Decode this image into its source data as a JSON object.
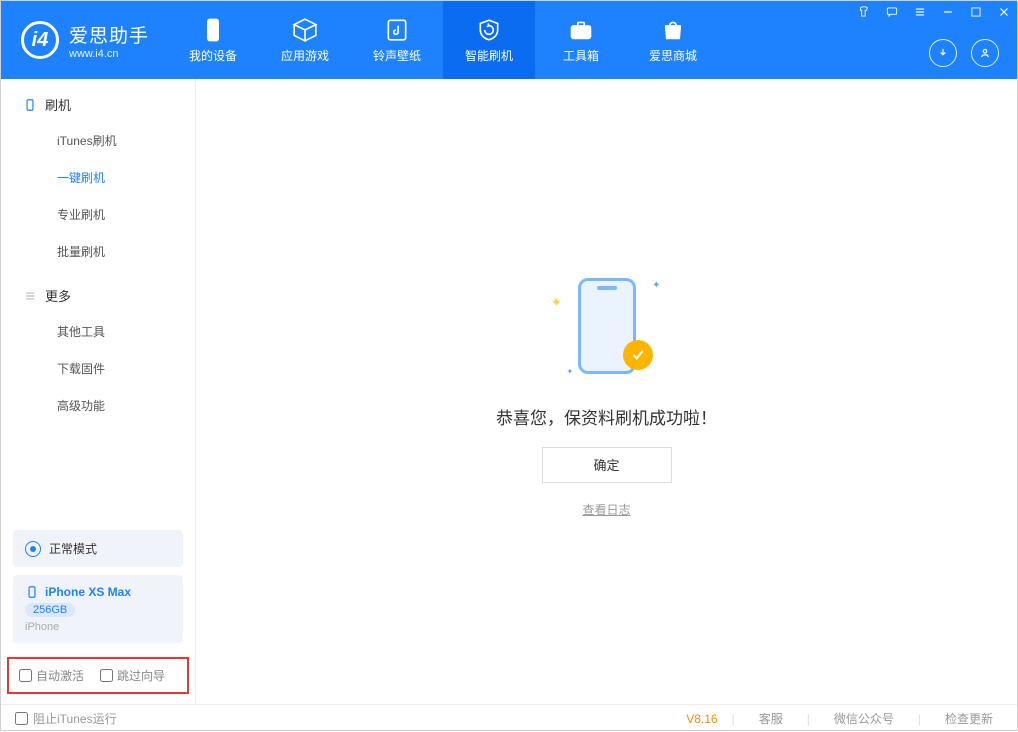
{
  "logo": {
    "cn": "爱思助手",
    "en": "www.i4.cn"
  },
  "nav": {
    "device": "我的设备",
    "apps": "应用游戏",
    "ring": "铃声壁纸",
    "flash": "智能刷机",
    "tools": "工具箱",
    "store": "爱思商城"
  },
  "sidebar": {
    "section_flash": "刷机",
    "itunes": "iTunes刷机",
    "oneclick": "一键刷机",
    "pro": "专业刷机",
    "batch": "批量刷机",
    "section_more": "更多",
    "othertools": "其他工具",
    "firmware": "下载固件",
    "advanced": "高级功能"
  },
  "status": {
    "mode": "正常模式"
  },
  "device": {
    "name": "iPhone XS Max",
    "capacity": "256GB",
    "type": "iPhone"
  },
  "opts": {
    "auto_activate": "自动激活",
    "skip_guide": "跳过向导"
  },
  "main": {
    "success": "恭喜您，保资料刷机成功啦！",
    "ok": "确定",
    "viewlog": "查看日志"
  },
  "footer": {
    "block_itunes": "阻止iTunes运行",
    "version": "V8.16",
    "cs": "客服",
    "wechat": "微信公众号",
    "update": "检查更新"
  }
}
